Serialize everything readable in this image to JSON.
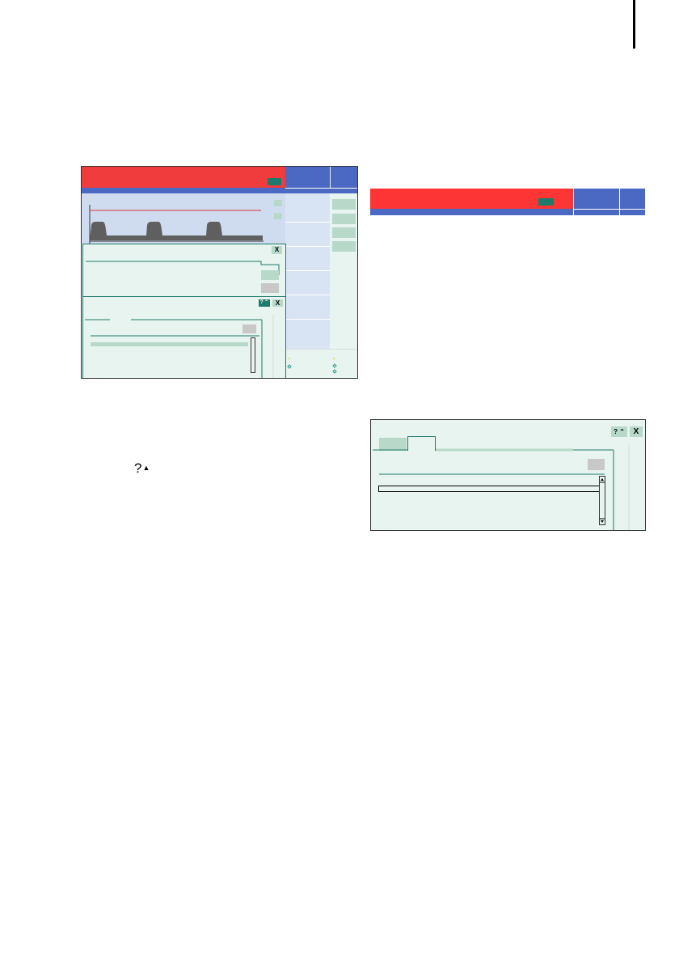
{
  "help_glyph": {
    "question": "?",
    "arrow": "▲"
  },
  "dialog": {
    "help_label": "? ⌃",
    "close_label": "X"
  },
  "screen": {
    "close_label": "X",
    "help_label": "? ⌃"
  },
  "colors": {
    "alarm_red": "#f03c3c",
    "header_blue": "#4b68c3",
    "panel_green": "#e8f4ef",
    "accent_teal": "#1e7a6a",
    "button_green": "#b8d8ca"
  }
}
